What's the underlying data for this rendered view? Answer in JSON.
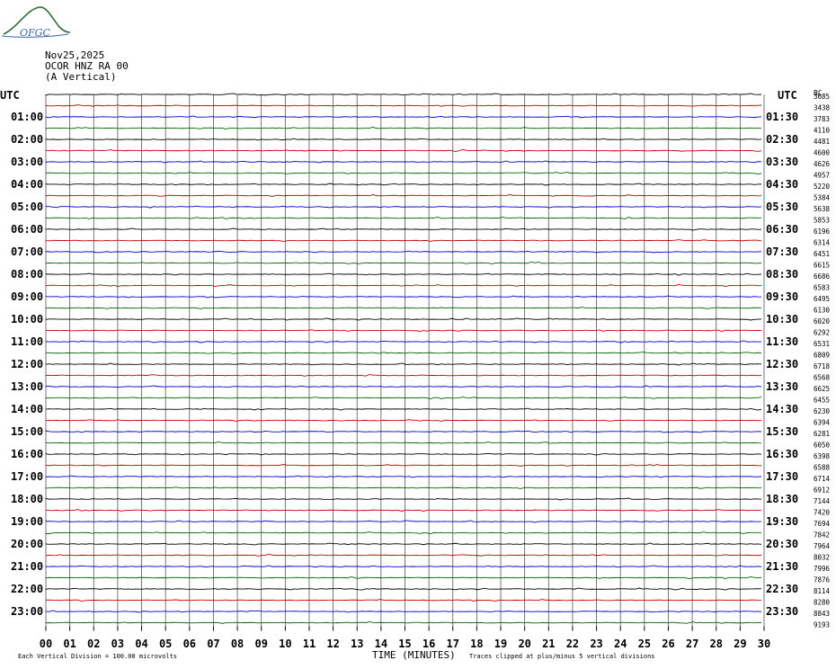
{
  "logo": {
    "text": "OFGC",
    "icon": "ofgc-logo-icon",
    "color": "#2a6f3a"
  },
  "header": {
    "date": "Nov25,2025",
    "station": "OCOR HNZ RA 00",
    "component": "(A Vertical)"
  },
  "colors": {
    "trace": [
      "#000000",
      "#cc0000",
      "#0000cc",
      "#006600"
    ],
    "grid": "#555555"
  },
  "chart_data": {
    "type": "line",
    "title": "",
    "left_axis_label": "UTC",
    "right_axis_label": "UTC",
    "right_col_label": "BC",
    "xlabel": "TIME (MINUTES)",
    "xlim": [
      0,
      30
    ],
    "x_ticks": [
      "00",
      "01",
      "02",
      "03",
      "04",
      "05",
      "06",
      "07",
      "08",
      "09",
      "10",
      "11",
      "12",
      "13",
      "14",
      "15",
      "16",
      "17",
      "18",
      "19",
      "20",
      "21",
      "22",
      "23",
      "24",
      "25",
      "26",
      "27",
      "28",
      "29",
      "30"
    ],
    "left_hour_labels": [
      "01:00",
      "02:00",
      "03:00",
      "04:00",
      "05:00",
      "06:00",
      "07:00",
      "08:00",
      "09:00",
      "10:00",
      "11:00",
      "12:00",
      "13:00",
      "14:00",
      "15:00",
      "16:00",
      "17:00",
      "18:00",
      "19:00",
      "20:00",
      "21:00",
      "22:00",
      "23:00"
    ],
    "right_hour_labels": [
      "01:30",
      "02:30",
      "03:30",
      "04:30",
      "05:30",
      "06:30",
      "07:30",
      "08:30",
      "09:30",
      "10:30",
      "11:30",
      "12:30",
      "13:30",
      "14:30",
      "15:30",
      "16:30",
      "17:30",
      "18:30",
      "19:30",
      "20:30",
      "21:30",
      "22:30",
      "23:30"
    ],
    "right_counts": [
      "3685",
      "3438",
      "3783",
      "4110",
      "4481",
      "4600",
      "4626",
      "4957",
      "5220",
      "5384",
      "5638",
      "5853",
      "6196",
      "6314",
      "6451",
      "6615",
      "6686",
      "6583",
      "6495",
      "6130",
      "6020",
      "6292",
      "6531",
      "6809",
      "6718",
      "6568",
      "6625",
      "6455",
      "6230",
      "6394",
      "6281",
      "6050",
      "6398",
      "6588",
      "6714",
      "6912",
      "7144",
      "7420",
      "7694",
      "7842",
      "7964",
      "8032",
      "7996",
      "7876",
      "8114",
      "8280",
      "8843",
      "9193"
    ],
    "trace_count": 48,
    "footer_left": "Each Vertical Division =  100.00 microvolts",
    "footer_right": "Traces clipped at plus/minus 5 vertical divisions"
  }
}
